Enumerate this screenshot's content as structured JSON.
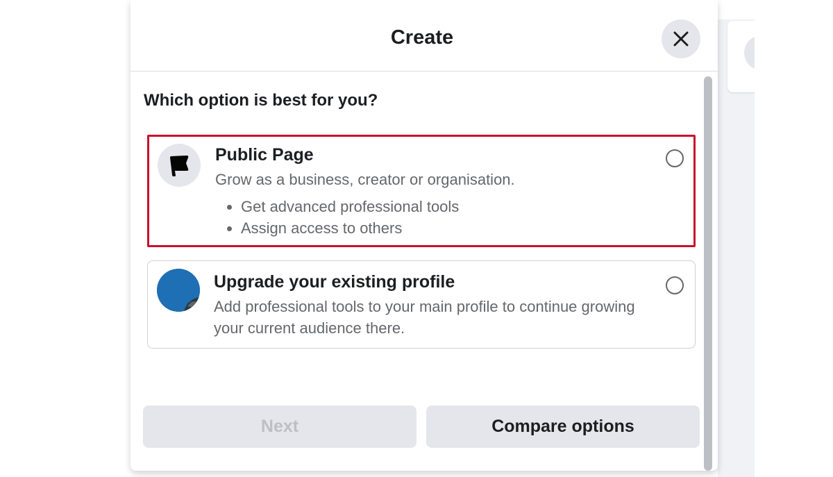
{
  "dialog": {
    "title": "Create",
    "question": "Which option is best for you?"
  },
  "options": [
    {
      "title": "Public Page",
      "description": "Grow as a business, creator or organisation.",
      "bullets": [
        "Get advanced professional tools",
        "Assign access to others"
      ],
      "icon": "flag-icon",
      "selected": false,
      "highlighted": true
    },
    {
      "title": "Upgrade your existing profile",
      "description": "Add professional tools to your main profile to continue growing your current audience there.",
      "icon": "profile-avatar",
      "selected": false,
      "highlighted": false
    }
  ],
  "buttons": {
    "next": "Next",
    "compare": "Compare options"
  },
  "colors": {
    "highlight_border": "#c8102e",
    "button_bg": "#e4e6eb",
    "disabled_text": "#bcc0c4",
    "secondary_text": "#65676b",
    "avatar_blue": "#1f6fb5"
  }
}
